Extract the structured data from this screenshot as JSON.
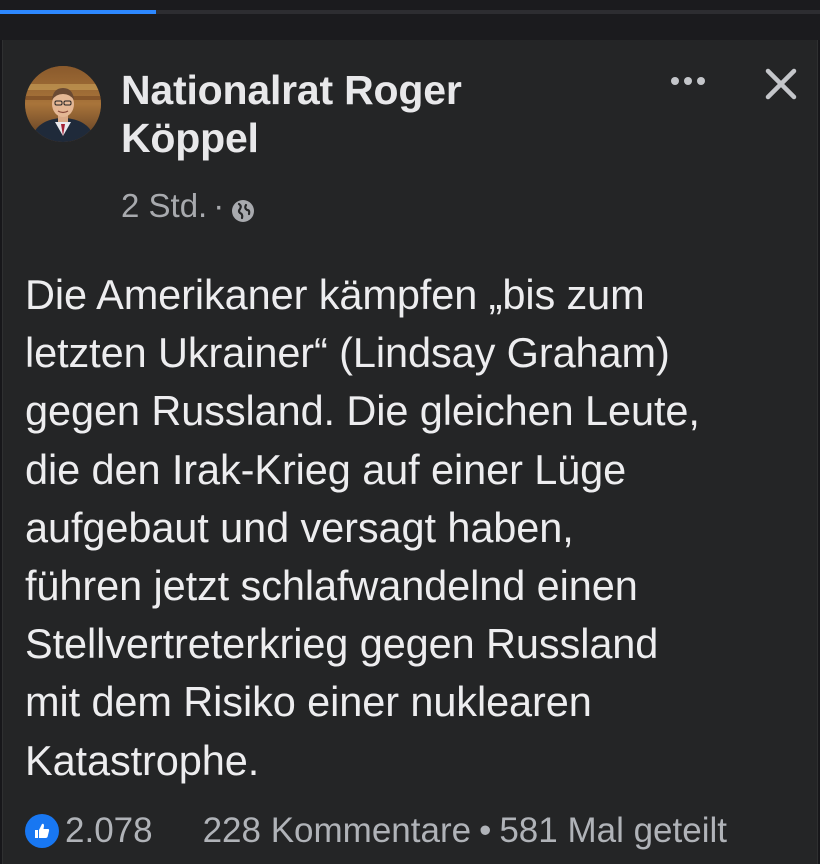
{
  "progress": {
    "fraction": 0.19,
    "color": "#2d88ff"
  },
  "post": {
    "author": "Nationalrat Roger Köppel",
    "timestamp": "2 Std.",
    "separator": "·",
    "privacy_icon": "globe-icon",
    "text": "Die Amerikaner kämpfen „bis zum\nletzten Ukrainer“ (Lindsay Graham)\ngegen Russland. Die gleichen Leute,\ndie den Irak-Krieg auf einer Lüge\naufgebaut und versagt haben,\nführen jetzt schlafwandelnd einen\nStellvertreterkrieg gegen Russland\nmit dem Risiko einer nuklearen\nKatastrophe."
  },
  "actions": {
    "more_icon": "more-options-icon",
    "close_icon": "close-icon"
  },
  "footer": {
    "reaction_icon": "like-icon",
    "reactions": "2.078",
    "comments": "228 Kommentare",
    "bullet": "•",
    "shares": "581 Mal geteilt"
  },
  "colors": {
    "background": "#17171a",
    "card": "#242526",
    "text": "#ededef",
    "secondary_text": "#a8aaae",
    "like_blue": "#1877f2"
  }
}
